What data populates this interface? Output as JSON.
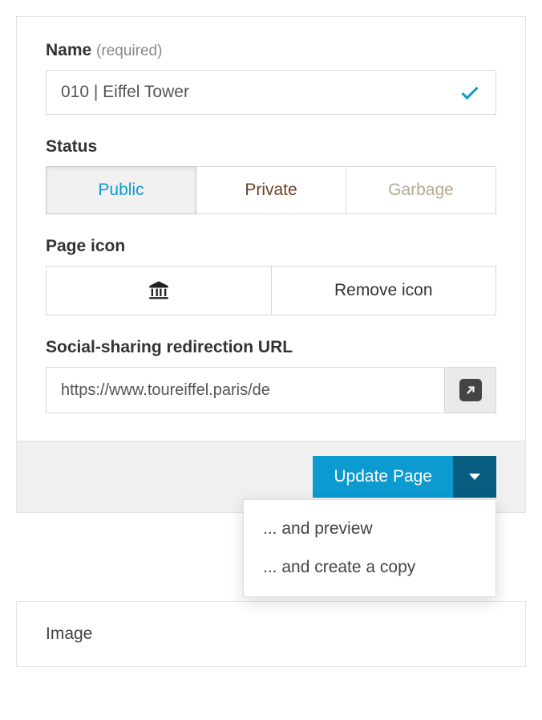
{
  "form": {
    "name": {
      "label": "Name",
      "required_hint": "(required)",
      "value": "010 | Eiffel Tower"
    },
    "status": {
      "label": "Status",
      "options": [
        "Public",
        "Private",
        "Garbage"
      ]
    },
    "page_icon": {
      "label": "Page icon",
      "remove_label": "Remove icon"
    },
    "social_url": {
      "label": "Social-sharing redirection URL",
      "value": "https://www.toureiffel.paris/de"
    }
  },
  "actions": {
    "primary": "Update Page",
    "dropdown": [
      "... and preview",
      "... and create a copy"
    ]
  },
  "next_panel": {
    "title": "Image"
  }
}
